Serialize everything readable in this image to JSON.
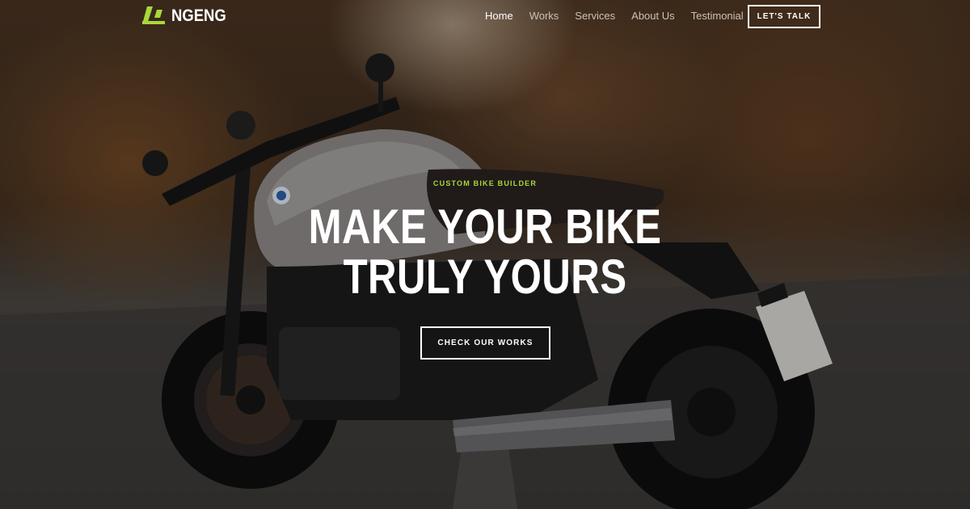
{
  "brand": {
    "name": "NGENG",
    "logo_icon": "slash-logo-icon",
    "accent_color": "#a8d83a"
  },
  "nav": {
    "links": [
      {
        "label": "Home",
        "active": true
      },
      {
        "label": "Works",
        "active": false
      },
      {
        "label": "Services",
        "active": false
      },
      {
        "label": "About Us",
        "active": false
      },
      {
        "label": "Testimonial",
        "active": false
      }
    ],
    "cta_label": "LET'S TALK"
  },
  "hero": {
    "eyebrow": "CUSTOM BIKE BUILDER",
    "headline_line1": "MAKE YOUR BIKE",
    "headline_line2": "TRULY YOURS",
    "cta_label": "CHECK OUR WORKS",
    "background": "motorcycle-photo"
  }
}
